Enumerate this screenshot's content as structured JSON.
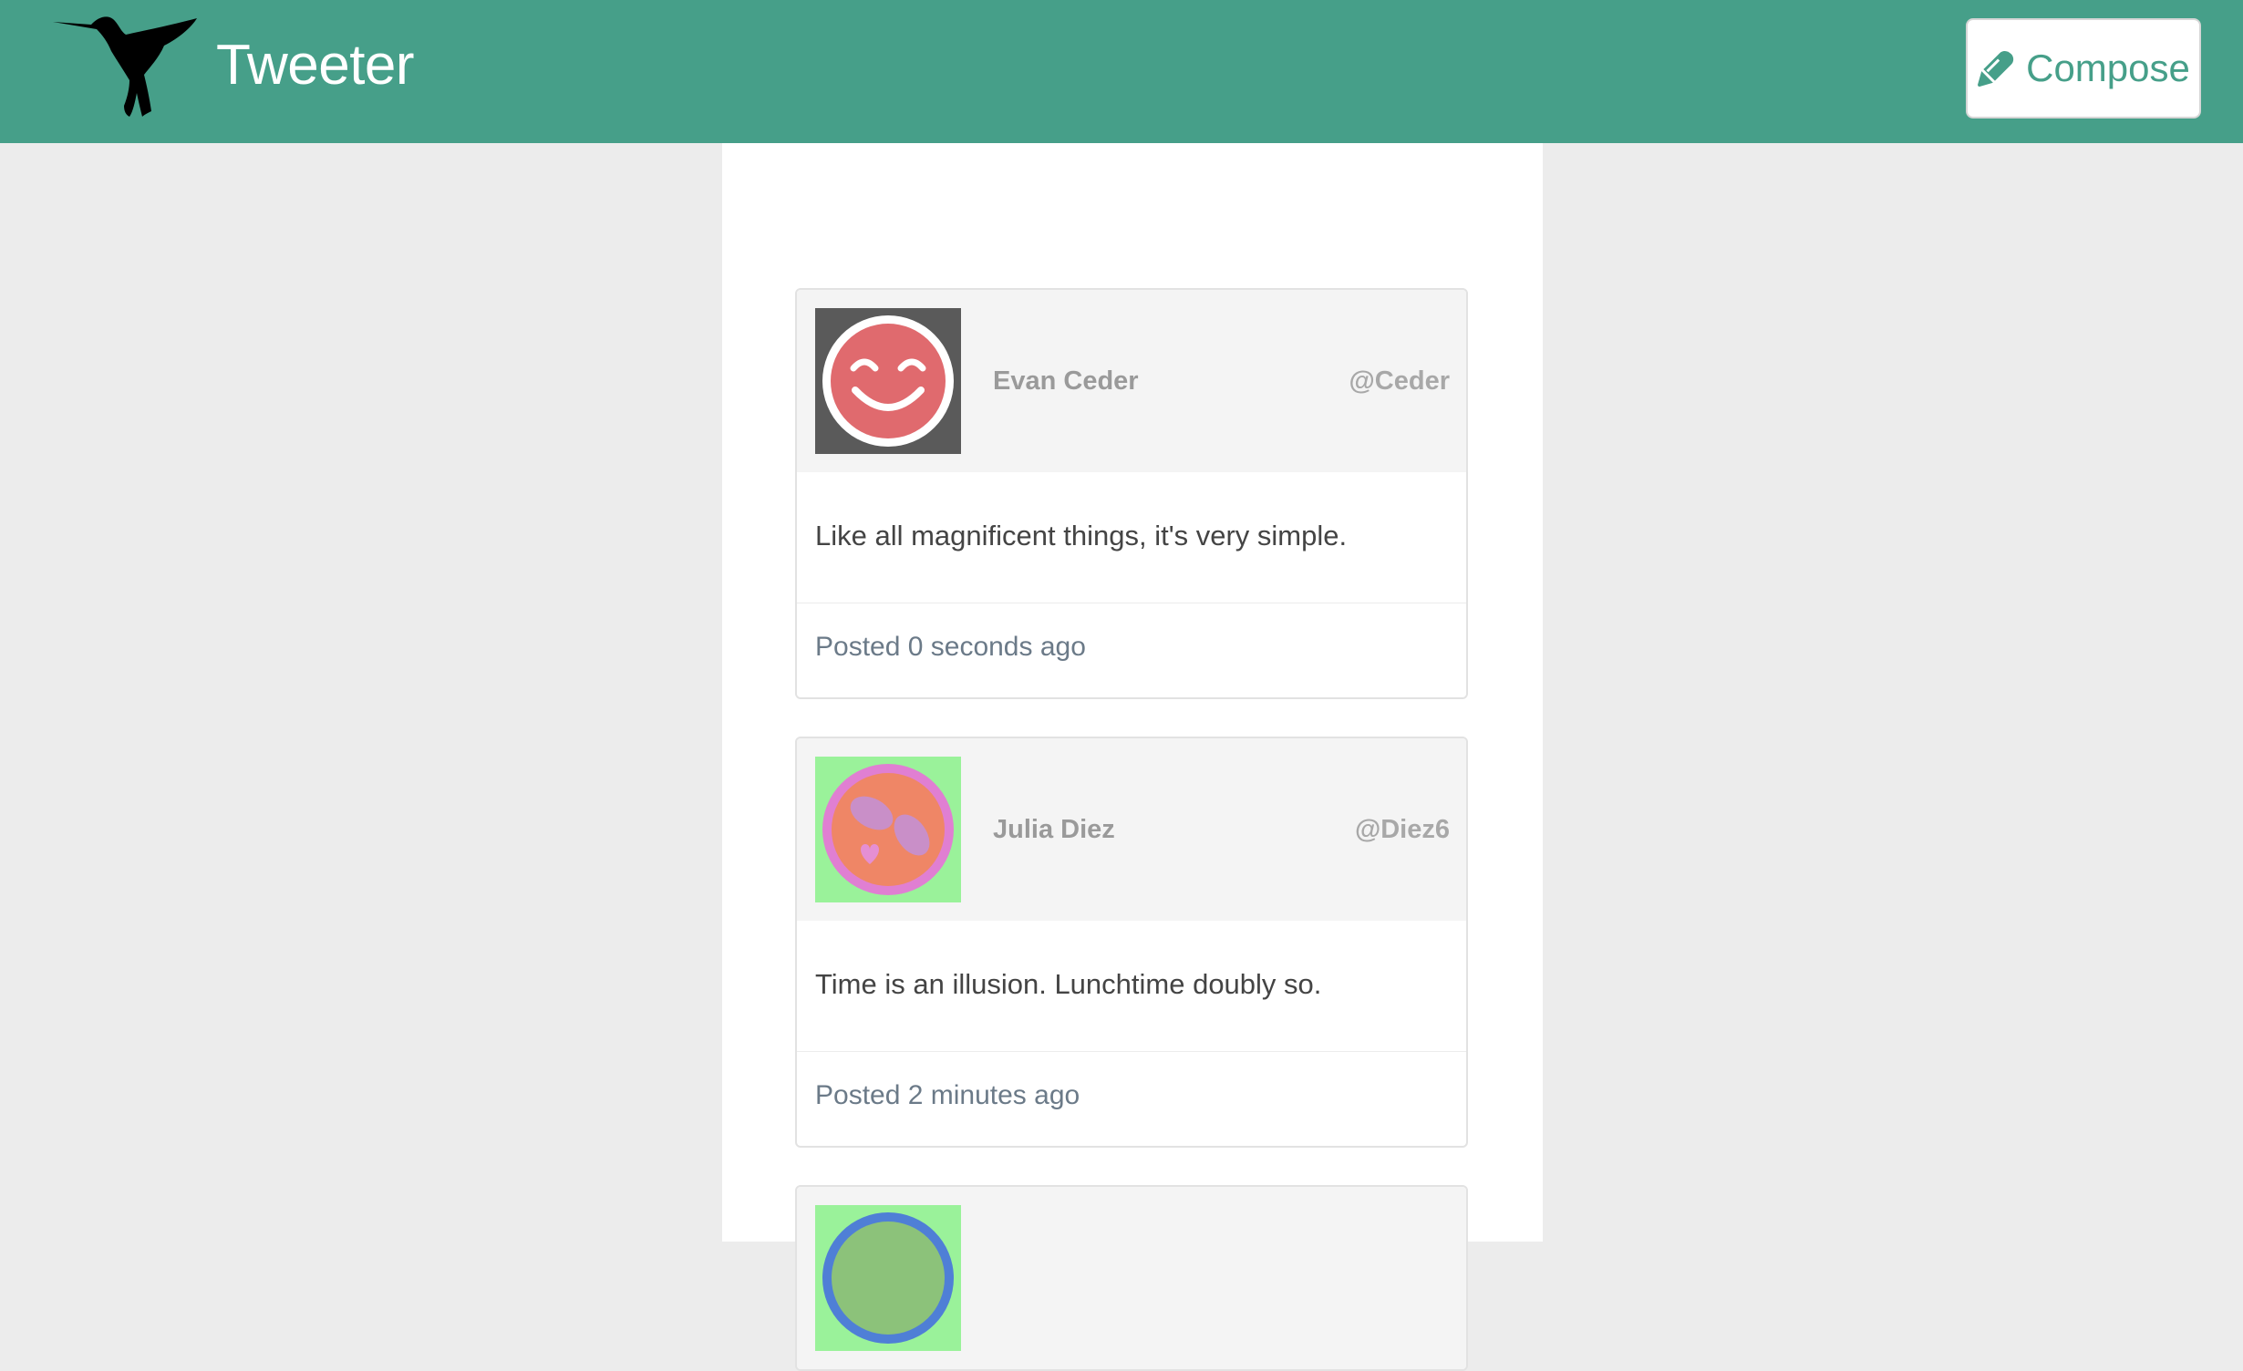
{
  "header": {
    "title": "Tweeter",
    "compose_label": "Compose",
    "logo_icon": "hummingbird-icon",
    "compose_icon": "pen-icon",
    "bg_color": "#469f89"
  },
  "tweets": [
    {
      "name": "Evan Ceder",
      "handle": "@Ceder",
      "text": "Like all magnificent things, it's very simple.",
      "posted": "Posted 0 seconds ago",
      "avatar_icon": "smiley-face-icon"
    },
    {
      "name": "Julia Diez",
      "handle": "@Diez6",
      "text": "Time is an illusion. Lunchtime doubly so.",
      "posted": "Posted 2 minutes ago",
      "avatar_icon": "sunglasses-face-icon"
    },
    {
      "name": "",
      "handle": "",
      "text": "",
      "posted": "",
      "avatar_icon": "face-icon"
    }
  ]
}
